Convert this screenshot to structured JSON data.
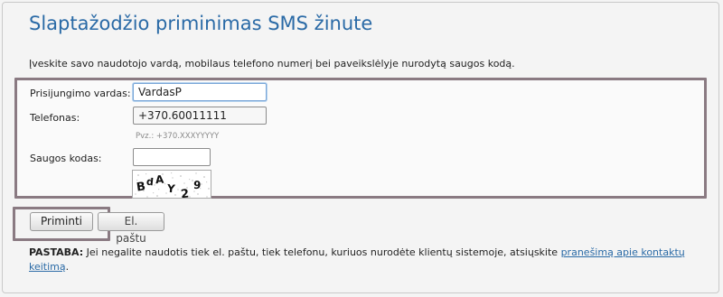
{
  "page": {
    "title": "Slaptažodžio priminimas SMS žinute",
    "intro": "Įveskite savo naudotojo vardą, mobilaus telefono numerį bei paveikslėlyje nurodytą saugos kodą."
  },
  "form": {
    "username_label": "Prisijungimo vardas:",
    "username_value": "VardasP",
    "phone_label": "Telefonas:",
    "phone_value": "+370.60011111",
    "phone_hint": "Pvz.: +370.XXXYYYYY",
    "security_label": "Saugos kodas:",
    "security_value": "",
    "captcha_chars": [
      "B",
      "d",
      "A",
      "Y",
      "2",
      "9"
    ]
  },
  "buttons": {
    "remind_label": "Priminti",
    "email_label": "El. paštu"
  },
  "note": {
    "prefix": "PASTABA:",
    "text": " Jei negalite naudotis tiek el. paštu, tiek telefonu, kuriuos nurodėte klientų sistemoje, atsiųskite ",
    "link_text": "pranešimą apie kontaktų keitimą",
    "suffix": "."
  },
  "colors": {
    "title": "#2a6aa6",
    "link": "#2a6aa6",
    "highlight_border": "#8a7a82"
  }
}
